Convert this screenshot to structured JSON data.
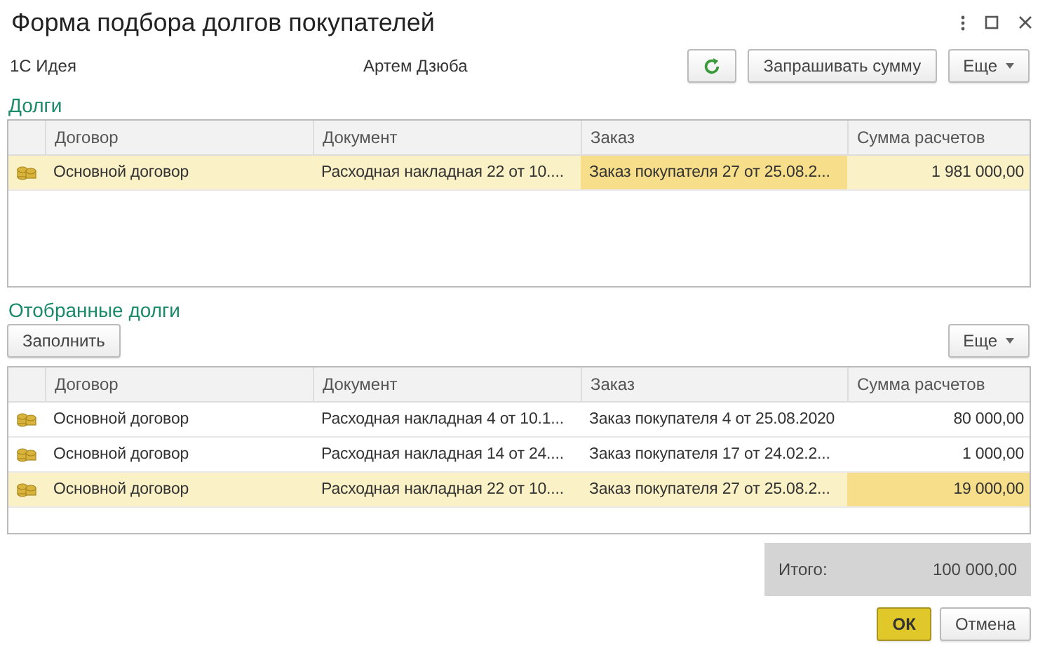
{
  "window": {
    "title": "Форма подбора долгов покупателей"
  },
  "header": {
    "organization": "1С Идея",
    "manager": "Артем Дзюба",
    "ask_sum_button": "Запрашивать сумму",
    "more_button": "Еще"
  },
  "debts": {
    "title": "Долги",
    "columns": [
      "Договор",
      "Документ",
      "Заказ",
      "Сумма расчетов"
    ],
    "rows": [
      {
        "selected": true,
        "cells": [
          {
            "text": "Основной договор",
            "focused": false
          },
          {
            "text": "Расходная накладная 22 от 10....",
            "focused": false
          },
          {
            "text": "Заказ покупателя 27 от 25.08.2...",
            "focused": true
          },
          {
            "text": "1 981 000,00",
            "focused": false
          }
        ]
      }
    ]
  },
  "selected_debts": {
    "title": "Отобранные долги",
    "fill_button": "Заполнить",
    "more_button": "Еще",
    "columns": [
      "Договор",
      "Документ",
      "Заказ",
      "Сумма расчетов"
    ],
    "rows": [
      {
        "selected": false,
        "cells": [
          {
            "text": "Основной договор",
            "focused": false
          },
          {
            "text": "Расходная накладная 4 от 10.1...",
            "focused": false
          },
          {
            "text": "Заказ покупателя 4 от 25.08.2020",
            "focused": false
          },
          {
            "text": "80 000,00",
            "focused": false
          }
        ]
      },
      {
        "selected": false,
        "cells": [
          {
            "text": "Основной договор",
            "focused": false
          },
          {
            "text": "Расходная накладная 14 от 24....",
            "focused": false
          },
          {
            "text": "Заказ покупателя 17 от 24.02.2...",
            "focused": false
          },
          {
            "text": "1 000,00",
            "focused": false
          }
        ]
      },
      {
        "selected": true,
        "cells": [
          {
            "text": "Основной договор",
            "focused": false
          },
          {
            "text": "Расходная накладная 22 от 10....",
            "focused": false
          },
          {
            "text": "Заказ покупателя 27 от 25.08.2...",
            "focused": false
          },
          {
            "text": "19 000,00",
            "focused": true
          }
        ]
      }
    ]
  },
  "total": {
    "label": "Итого:",
    "value": "100 000,00"
  },
  "buttons": {
    "ok": "ОК",
    "cancel": "Отмена"
  }
}
